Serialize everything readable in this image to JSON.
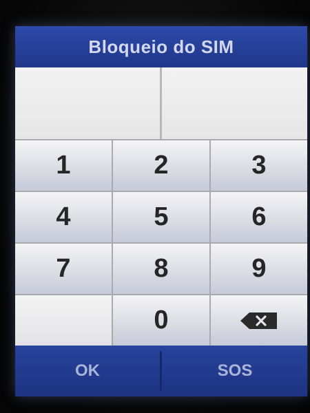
{
  "header": {
    "title": "Bloqueio do SIM"
  },
  "pin_entry": {
    "value": ""
  },
  "keypad": {
    "keys": [
      "1",
      "2",
      "3",
      "4",
      "5",
      "6",
      "7",
      "8",
      "9",
      "",
      "0",
      "backspace-icon"
    ]
  },
  "softkeys": {
    "left_label": "OK",
    "right_label": "SOS"
  },
  "colors": {
    "title_bar": "#2c4aa8",
    "softkey_bar": "#27439c",
    "key_text": "#262626"
  }
}
